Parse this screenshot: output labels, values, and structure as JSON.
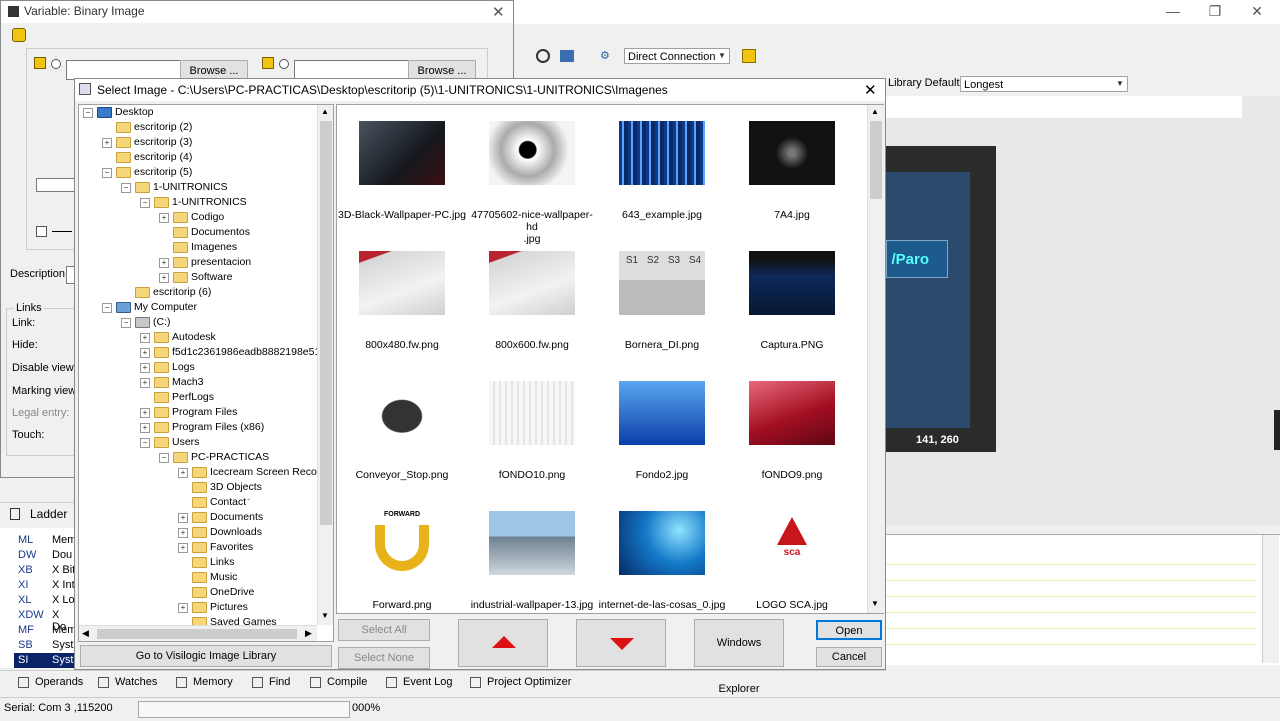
{
  "app": {
    "window_controls": {
      "minimize": "—",
      "maximize": "❐",
      "close": "✕"
    },
    "toolbar": {
      "connection": "Direct Connection",
      "library_label": "Library Default",
      "library_value": "Longest"
    },
    "hmi": {
      "button_label": "/Paro",
      "coord": "141, 260"
    }
  },
  "variable_window": {
    "title": "Variable: Binary Image",
    "browse_1": "Browse ...",
    "browse_2": "Browse ...",
    "description_label": "Description :",
    "links_group": "Links",
    "link_labels": [
      "Link:",
      "Hide:",
      "Disable view:",
      "Marking view:",
      "Legal entry:",
      "Touch:"
    ],
    "ladder_tab": "Ladder"
  },
  "operands": [
    {
      "code": "ML",
      "desc": "Mem"
    },
    {
      "code": "DW",
      "desc": "Dou"
    },
    {
      "code": "XB",
      "desc": "X Bit"
    },
    {
      "code": "XI",
      "desc": "X Int"
    },
    {
      "code": "XL",
      "desc": "X Lo"
    },
    {
      "code": "XDW",
      "desc": "X Do"
    },
    {
      "code": "MF",
      "desc": "Mem"
    },
    {
      "code": "SB",
      "desc": "Syst"
    },
    {
      "code": "SI",
      "desc": "Syst"
    }
  ],
  "bottom_tabs": [
    "Operands",
    "Watches",
    "Memory",
    "Find",
    "Compile",
    "Event Log",
    "Project Optimizer"
  ],
  "status": {
    "serial": "Serial:  Com 3 ,115200",
    "percent": "000%"
  },
  "dialog": {
    "title": "Select Image - C:\\Users\\PC-PRACTICAS\\Desktop\\escritorip (5)\\1-UNITRONICS\\1-UNITRONICS\\Imagenes",
    "tree": [
      {
        "label": "Desktop",
        "level": 0,
        "exp": "-",
        "icon": "desktop-icon"
      },
      {
        "label": "escritorip (2)",
        "level": 1,
        "exp": "",
        "icon": "folder-icon"
      },
      {
        "label": "escritorip (3)",
        "level": 1,
        "exp": "+",
        "icon": "folder-icon"
      },
      {
        "label": "escritorip (4)",
        "level": 1,
        "exp": "",
        "icon": "folder-icon"
      },
      {
        "label": "escritorip (5)",
        "level": 1,
        "exp": "-",
        "icon": "folder-icon"
      },
      {
        "label": "1-UNITRONICS",
        "level": 2,
        "exp": "-",
        "icon": "folder-icon"
      },
      {
        "label": "1-UNITRONICS",
        "level": 3,
        "exp": "-",
        "icon": "folder-icon"
      },
      {
        "label": "Codigo",
        "level": 4,
        "exp": "+",
        "icon": "folder-icon"
      },
      {
        "label": "Documentos",
        "level": 4,
        "exp": "",
        "icon": "folder-icon"
      },
      {
        "label": "Imagenes",
        "level": 4,
        "exp": "",
        "icon": "folder-icon"
      },
      {
        "label": "presentacion",
        "level": 4,
        "exp": "+",
        "icon": "folder-icon"
      },
      {
        "label": "Software",
        "level": 4,
        "exp": "+",
        "icon": "folder-icon"
      },
      {
        "label": "escritorip (6)",
        "level": 2,
        "exp": "",
        "icon": "folder-icon"
      },
      {
        "label": "My Computer",
        "level": 1,
        "exp": "-",
        "icon": "computer-icon"
      },
      {
        "label": "(C:)",
        "level": 2,
        "exp": "-",
        "icon": "drive-icon"
      },
      {
        "label": "Autodesk",
        "level": 3,
        "exp": "+",
        "icon": "folder-icon"
      },
      {
        "label": "f5d1c2361986eadb8882198e51",
        "level": 3,
        "exp": "+",
        "icon": "folder-icon"
      },
      {
        "label": "Logs",
        "level": 3,
        "exp": "+",
        "icon": "folder-icon"
      },
      {
        "label": "Mach3",
        "level": 3,
        "exp": "+",
        "icon": "folder-icon"
      },
      {
        "label": "PerfLogs",
        "level": 3,
        "exp": "",
        "icon": "folder-icon"
      },
      {
        "label": "Program Files",
        "level": 3,
        "exp": "+",
        "icon": "folder-icon"
      },
      {
        "label": "Program Files (x86)",
        "level": 3,
        "exp": "+",
        "icon": "folder-icon"
      },
      {
        "label": "Users",
        "level": 3,
        "exp": "-",
        "icon": "folder-icon"
      },
      {
        "label": "PC-PRACTICAS",
        "level": 4,
        "exp": "-",
        "icon": "folder-icon"
      },
      {
        "label": "Icecream Screen Reco",
        "level": 5,
        "exp": "+",
        "icon": "folder-icon"
      },
      {
        "label": "3D Objects",
        "level": 5,
        "exp": "",
        "icon": "folder-icon"
      },
      {
        "label": "Contacts",
        "level": 5,
        "exp": "",
        "icon": "folder-icon"
      },
      {
        "label": "Documents",
        "level": 5,
        "exp": "+",
        "icon": "folder-icon"
      },
      {
        "label": "Downloads",
        "level": 5,
        "exp": "+",
        "icon": "folder-icon"
      },
      {
        "label": "Favorites",
        "level": 5,
        "exp": "+",
        "icon": "folder-icon"
      },
      {
        "label": "Links",
        "level": 5,
        "exp": "",
        "icon": "folder-icon"
      },
      {
        "label": "Music",
        "level": 5,
        "exp": "",
        "icon": "folder-icon"
      },
      {
        "label": "OneDrive",
        "level": 5,
        "exp": "",
        "icon": "folder-icon"
      },
      {
        "label": "Pictures",
        "level": 5,
        "exp": "+",
        "icon": "folder-icon"
      },
      {
        "label": "Saved Games",
        "level": 5,
        "exp": "",
        "icon": "folder-icon"
      }
    ],
    "images": [
      {
        "name": "3D-Black-Wallpaper-PC.jpg",
        "look": "dark-tech"
      },
      {
        "name": "47705602-nice-wallpaper-hd\n.jpg",
        "look": "disc"
      },
      {
        "name": "643_example.jpg",
        "look": "blue-lines"
      },
      {
        "name": "7A4.jpg",
        "look": "circuit"
      },
      {
        "name": "800x480.fw.png",
        "look": "silver-red"
      },
      {
        "name": "800x600.fw.png",
        "look": "silver-red"
      },
      {
        "name": "Bornera_DI.png",
        "look": "terminals"
      },
      {
        "name": "Captura.PNG",
        "look": "dark-blue"
      },
      {
        "name": "Conveyor_Stop.png",
        "look": "conveyor"
      },
      {
        "name": "fONDO10.png",
        "look": "light-gray"
      },
      {
        "name": "Fondo2.jpg",
        "look": "blue-gradient"
      },
      {
        "name": "fONDO9.png",
        "look": "red-wave"
      },
      {
        "name": "Forward.png",
        "look": "arrow"
      },
      {
        "name": "industrial-wallpaper-13.jpg",
        "look": "factory"
      },
      {
        "name": "internet-de-las-cosas_0.jpg",
        "look": "iot"
      },
      {
        "name": "LOGO SCA.jpg",
        "look": "logo"
      }
    ],
    "forward_logo_text": "FORWARD",
    "sca_logo_text": "sca",
    "terminal_labels": [
      "S1",
      "S2",
      "S3",
      "S4"
    ],
    "buttons": {
      "select_all": "Select All",
      "select_none": "Select None",
      "windows_explorer": "Windows Explorer",
      "open": "Open",
      "cancel": "Cancel",
      "go_library": "Go to Visilogic Image Library"
    }
  }
}
